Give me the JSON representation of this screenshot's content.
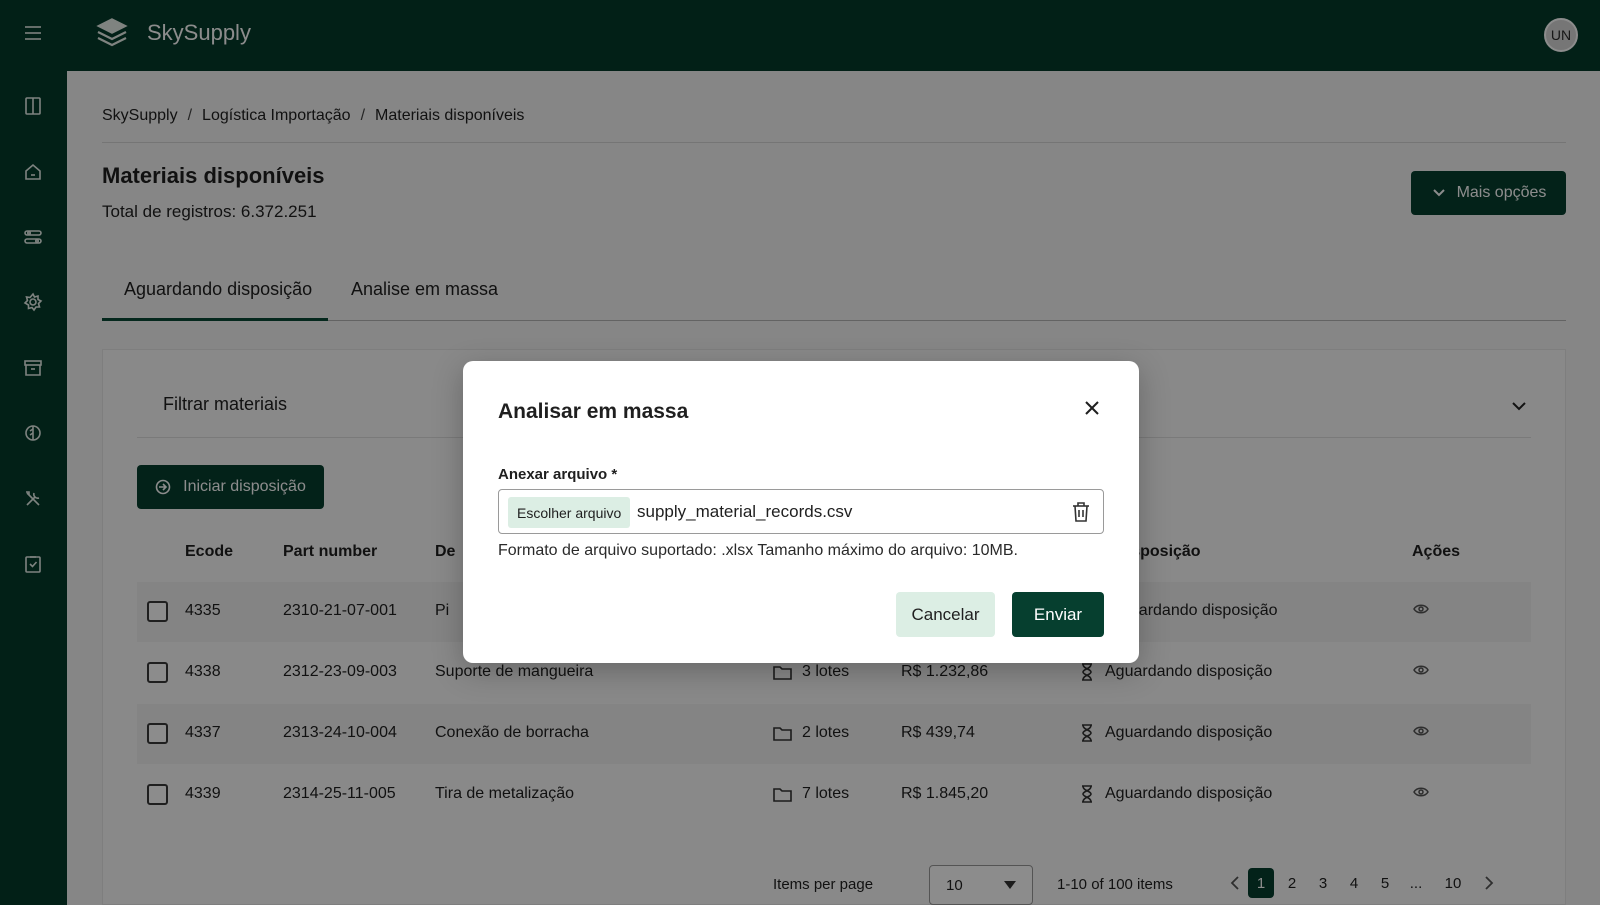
{
  "app": {
    "name": "SkySupply",
    "avatar_initials": "UN"
  },
  "breadcrumb": [
    "SkySupply",
    "Logística Importação",
    "Materiais disponíveis"
  ],
  "breadcrumb_sep": "/",
  "page": {
    "title": "Materiais disponíveis",
    "total": "Total de registros: 6.372.251",
    "more_options": "Mais opções"
  },
  "tabs": [
    {
      "label": "Aguardando disposição",
      "active": true
    },
    {
      "label": "Analise em massa",
      "active": false
    }
  ],
  "filter": {
    "title": "Filtrar materiais"
  },
  "actions": {
    "start_disposition": "Iniciar disposição"
  },
  "table": {
    "headers": {
      "ecode": "Ecode",
      "part_number": "Part number",
      "description_partial": "De",
      "status_partial": "disposição",
      "actions": "Ações"
    },
    "rows": [
      {
        "ecode": "4335",
        "part_number": "2310-21-07-001",
        "description": "Pi",
        "lots": "",
        "value": "",
        "status": "guardando disposição"
      },
      {
        "ecode": "4338",
        "part_number": "2312-23-09-003",
        "description": "Suporte de mangueira",
        "lots": "3 lotes",
        "value": "R$ 1.232,86",
        "status": "Aguardando disposição"
      },
      {
        "ecode": "4337",
        "part_number": "2313-24-10-004",
        "description": "Conexão de borracha",
        "lots": "2 lotes",
        "value": "R$ 439,74",
        "status": "Aguardando disposição"
      },
      {
        "ecode": "4339",
        "part_number": "2314-25-11-005",
        "description": "Tira de metalização",
        "lots": "7 lotes",
        "value": "R$ 1.845,20",
        "status": "Aguardando disposição"
      }
    ]
  },
  "pagination": {
    "items_per_page_label": "Items per page",
    "items_per_page_value": "10",
    "range": "1-10 of 100 items",
    "pages": [
      "1",
      "2",
      "3",
      "4",
      "5",
      "...",
      "10"
    ],
    "current": "1"
  },
  "modal": {
    "title": "Analisar em massa",
    "field_label": "Anexar arquivo *",
    "choose_button": "Escolher arquivo",
    "file_name": "supply_material_records.csv",
    "hint": "Formato de arquivo suportado: .xlsx Tamanho máximo do arquivo: 10MB.",
    "cancel": "Cancelar",
    "submit": "Enviar"
  },
  "icons": {
    "rail": [
      "menu-icon",
      "sidebar-panel-icon",
      "home-icon",
      "toggles-icon",
      "gear-icon",
      "archive-icon",
      "half-circle-icon",
      "tools-icon",
      "checklist-icon"
    ],
    "logo": "stacked-layers-icon"
  },
  "colors": {
    "brand": "#053b2b",
    "button": "#063f2f",
    "secondary_button": "#dceee4"
  }
}
